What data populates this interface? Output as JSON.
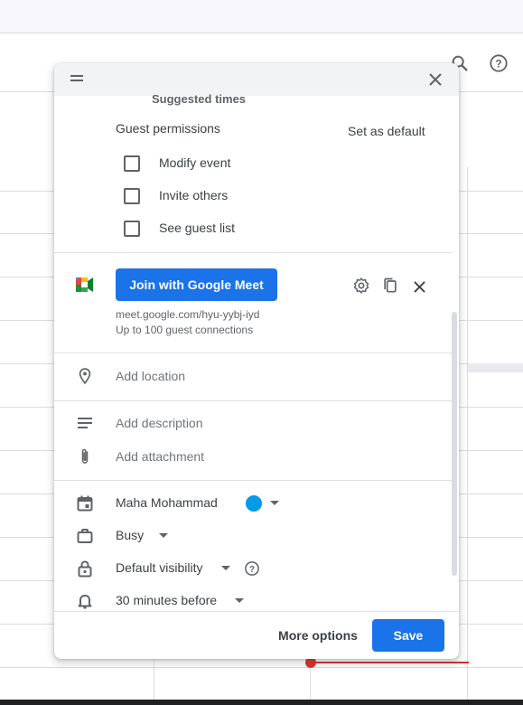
{
  "dialog": {
    "partial_heading": "Suggested times",
    "guest_permissions": {
      "title": "Guest permissions",
      "set_default": "Set as default",
      "options": [
        {
          "label": "Modify event",
          "checked": false
        },
        {
          "label": "Invite others",
          "checked": false
        },
        {
          "label": "See guest list",
          "checked": false
        }
      ]
    },
    "meet": {
      "join_label": "Join with Google Meet",
      "link": "meet.google.com/hyu-yybj-iyd",
      "capacity": "Up to 100 guest connections"
    },
    "location_placeholder": "Add location",
    "description_placeholder": "Add description",
    "attachment_placeholder": "Add attachment",
    "calendar_owner": "Maha Mohammad",
    "calendar_color": "#039be5",
    "availability": "Busy",
    "visibility": "Default visibility",
    "notification": "30 minutes before",
    "footer": {
      "more_options": "More options",
      "save": "Save"
    }
  },
  "icons": {
    "search": "search-icon",
    "help": "help-icon",
    "close": "close-icon",
    "settings": "gear-icon",
    "copy": "copy-icon",
    "location": "location-pin-icon",
    "description": "notes-icon",
    "attachment": "paperclip-icon",
    "calendar": "calendar-icon",
    "briefcase": "briefcase-icon",
    "lock": "lock-icon",
    "bell": "bell-icon"
  },
  "colors": {
    "accent": "#1a73e8",
    "now_indicator": "#d93025"
  }
}
